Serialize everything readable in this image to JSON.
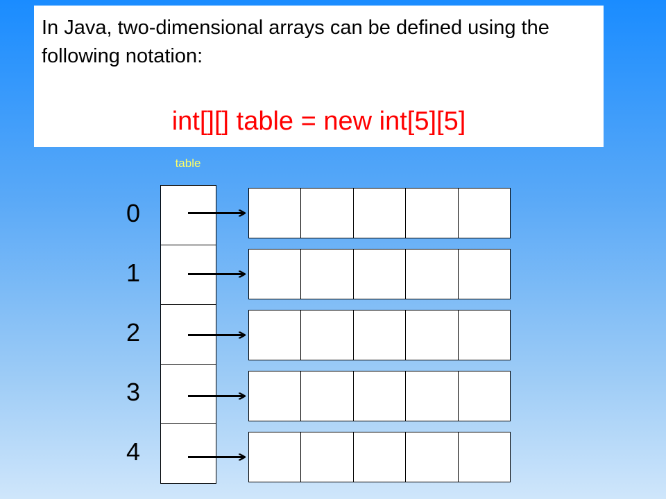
{
  "intro_text": "In Java, two-dimensional arrays can be defined using the following notation:",
  "code_text": "int[][] table = new int[5][5]",
  "variable_label": "table",
  "indices": [
    "0",
    "1",
    "2",
    "3",
    "4"
  ],
  "rows": 5,
  "cols": 5,
  "colors": {
    "code": "#ff0000",
    "variable_label": "#ffff66",
    "background_top": "#1a8cff",
    "background_bottom": "#cfe6fb"
  }
}
